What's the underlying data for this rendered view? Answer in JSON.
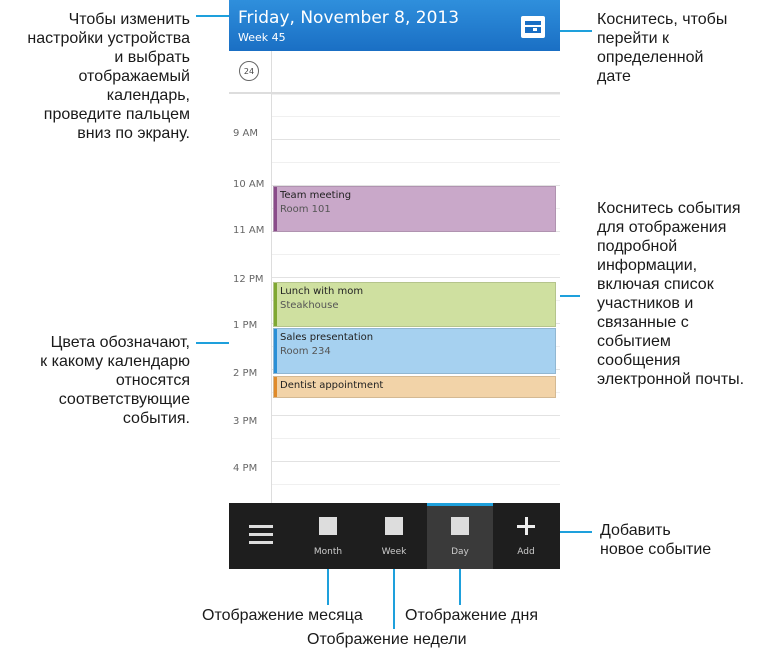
{
  "header": {
    "date": "Friday, November 8, 2013",
    "week": "Week 45"
  },
  "timezone_badge": "24",
  "hours": [
    "9 AM",
    "10 AM",
    "11 AM",
    "12 PM",
    "1 PM",
    "2 PM",
    "3 PM",
    "4 PM"
  ],
  "events": [
    {
      "title": "Team meeting",
      "subtitle": "Room 101",
      "bg": "#c9a8c9",
      "stripe": "#8a4c8a"
    },
    {
      "title": "Lunch with mom",
      "subtitle": "Steakhouse",
      "bg": "#cfe0a0",
      "stripe": "#7fa832"
    },
    {
      "title": "Sales presentation",
      "subtitle": "Room 234",
      "bg": "#a6d1f0",
      "stripe": "#2a8fd6"
    },
    {
      "title": "Dentist appointment",
      "subtitle": "",
      "bg": "#f2d3a8",
      "stripe": "#e08a2a"
    }
  ],
  "toolbar": {
    "month": "Month",
    "week": "Week",
    "day": "Day",
    "add": "Add"
  },
  "annotations": {
    "swipe": [
      "Чтобы изменить",
      "настройки устройства",
      "и выбрать",
      "отображаемый",
      "календарь,",
      "проведите пальцем",
      "вниз по экрану."
    ],
    "date": [
      "Коснитесь, чтобы",
      "перейти к",
      "определенной",
      "дате"
    ],
    "event": [
      "Коснитесь события",
      "для отображения",
      "подробной",
      "информации,",
      "включая список",
      "участников и",
      "связанные с",
      "событием",
      "сообщения",
      "электронной почты."
    ],
    "colors": [
      "Цвета обозначают,",
      "к какому календарю",
      "относятся",
      "соответствующие",
      "события."
    ],
    "add": [
      "Добавить",
      "новое событие"
    ],
    "month_view": "Отображение месяца",
    "week_view": "Отображение недели",
    "day_view": "Отображение дня"
  },
  "accent_color": "#1ea0dc"
}
